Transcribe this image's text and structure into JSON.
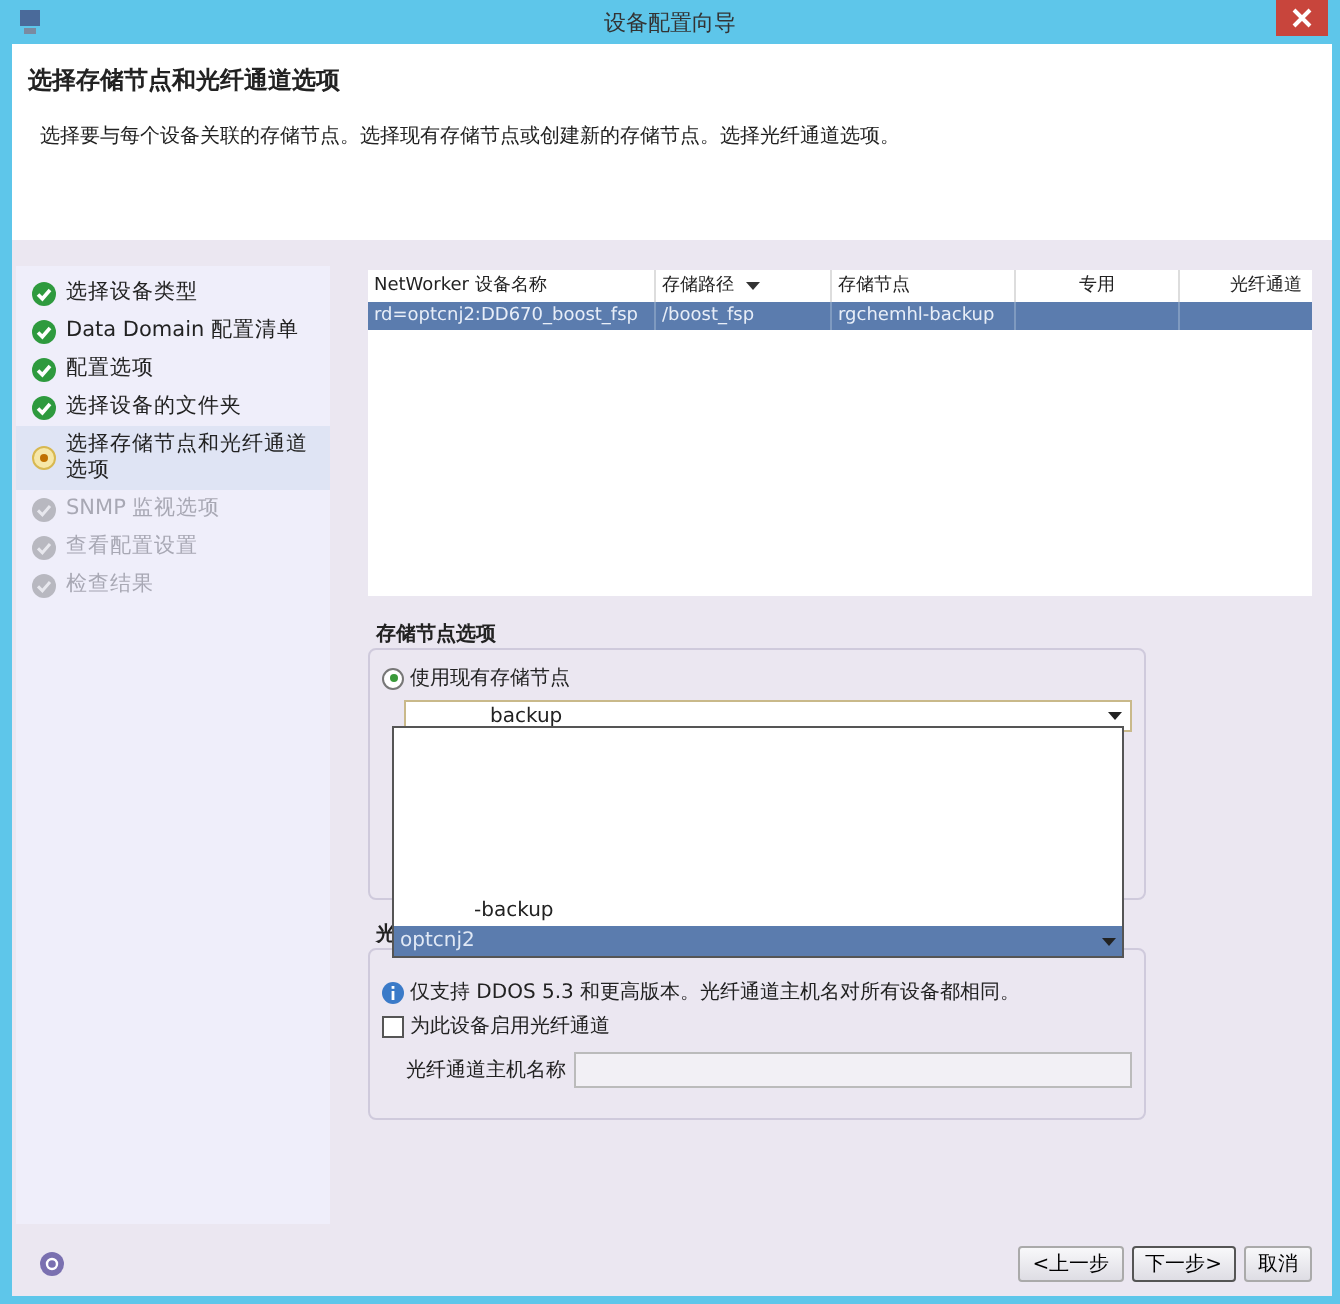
{
  "window": {
    "title": "设备配置向导"
  },
  "header": {
    "title": "选择存储节点和光纤通道选项",
    "description": "选择要与每个设备关联的存储节点。选择现有存储节点或创建新的存储节点。选择光纤通道选项。"
  },
  "steps": [
    {
      "label": "选择设备类型",
      "kind": "done",
      "selected": false
    },
    {
      "label": "Data Domain 配置清单",
      "kind": "done",
      "selected": false
    },
    {
      "label": "配置选项",
      "kind": "done",
      "selected": false
    },
    {
      "label": "选择设备的文件夹",
      "kind": "done",
      "selected": false
    },
    {
      "label": "选择存储节点和光纤通道选项",
      "kind": "current",
      "selected": true
    },
    {
      "label": "SNMP 监视选项",
      "kind": "pending",
      "selected": false
    },
    {
      "label": "查看配置设置",
      "kind": "pending",
      "selected": false
    },
    {
      "label": "检查结果",
      "kind": "pending",
      "selected": false
    }
  ],
  "table": {
    "columns": [
      {
        "label": "NetWorker 设备名称",
        "sorted": false
      },
      {
        "label": "存储路径",
        "sorted": true
      },
      {
        "label": "存储节点",
        "sorted": false
      },
      {
        "label": "专用",
        "sorted": false
      },
      {
        "label": "光纤通道",
        "sorted": false
      }
    ],
    "rows": [
      {
        "cells": [
          "rd=optcnj2:DD670_boost_fsp",
          "/boost_fsp",
          "rgchemhl-backup"
        ],
        "selected": true
      }
    ]
  },
  "storage_node_options": {
    "title": "存储节点选项",
    "use_existing": {
      "label": "使用现有存储节点",
      "selected": true
    },
    "dropdown": {
      "value": "backup",
      "items": [
        {
          "label": "-backup",
          "selected": false
        },
        {
          "label": "optcnj2",
          "selected": true
        }
      ]
    }
  },
  "fibre_channel": {
    "title": "光",
    "note": "仅支持 DDOS 5.3 和更高版本。光纤通道主机名对所有设备都相同。",
    "enable": {
      "label": "为此设备启用光纤通道",
      "checked": false
    },
    "hostname": {
      "label": "光纤通道主机名称"
    }
  },
  "buttons": [
    {
      "label": "<上一步",
      "default": false
    },
    {
      "label": "下一步>",
      "default": true
    },
    {
      "label": "取消",
      "default": false
    }
  ]
}
